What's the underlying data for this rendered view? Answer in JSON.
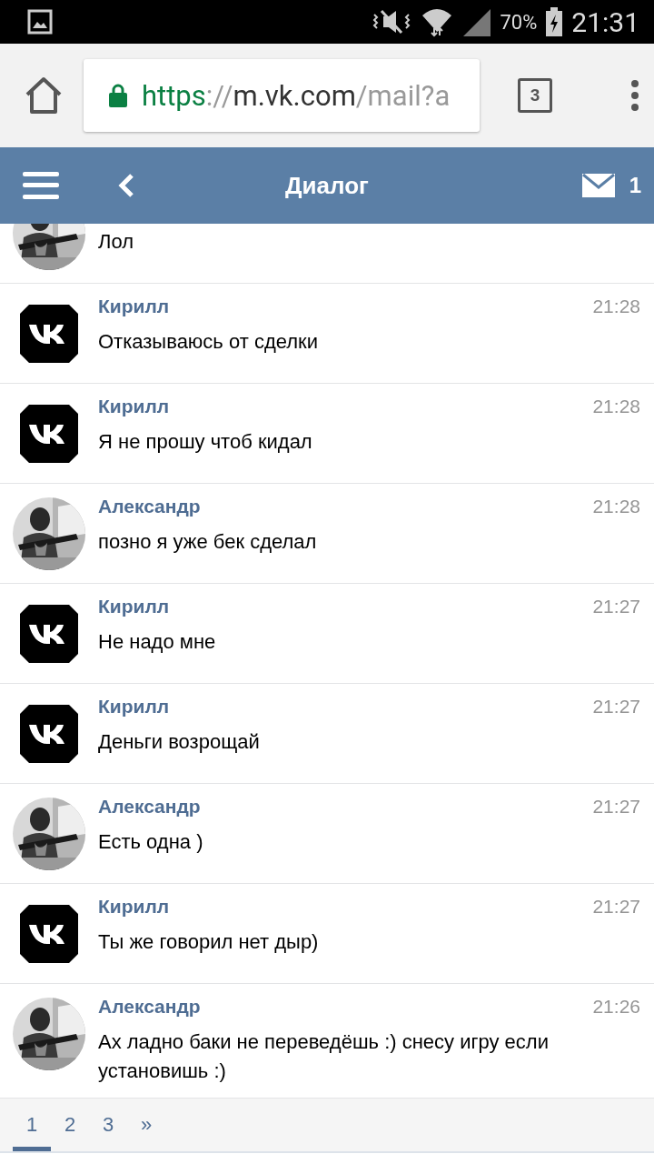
{
  "status_bar": {
    "battery": "70%",
    "time": "21:31"
  },
  "browser": {
    "url_scheme": "https",
    "url_sep": "://",
    "url_host": "m.vk.com",
    "url_path": "/mail?a",
    "tab_count": "3"
  },
  "header": {
    "title": "Диалог",
    "mail_count": "1"
  },
  "messages": [
    {
      "kind": "picture",
      "text": "Лол"
    },
    {
      "kind": "vk",
      "name": "Кирилл",
      "time": "21:28",
      "text": "Отказываюсь от сделки"
    },
    {
      "kind": "vk",
      "name": "Кирилл",
      "time": "21:28",
      "text": "Я не прошу чтоб кидал"
    },
    {
      "kind": "picture",
      "name": "Александр",
      "time": "21:28",
      "text": "позно я уже бек сделал"
    },
    {
      "kind": "vk",
      "name": "Кирилл",
      "time": "21:27",
      "text": "Не надо мне"
    },
    {
      "kind": "vk",
      "name": "Кирилл",
      "time": "21:27",
      "text": "Деньги возрощай"
    },
    {
      "kind": "picture",
      "name": "Александр",
      "time": "21:27",
      "text": "Есть одна )"
    },
    {
      "kind": "vk",
      "name": "Кирилл",
      "time": "21:27",
      "text": "Ты же говорил нет дыр)"
    },
    {
      "kind": "picture",
      "name": "Александр",
      "time": "21:26",
      "text": "Ах ладно баки не переведёшь :) снесу игру если установишь :)"
    }
  ],
  "pagination": [
    {
      "label": "1",
      "selected": true
    },
    {
      "label": "2",
      "selected": false
    },
    {
      "label": "3",
      "selected": false
    },
    {
      "label": "»",
      "selected": false
    }
  ]
}
